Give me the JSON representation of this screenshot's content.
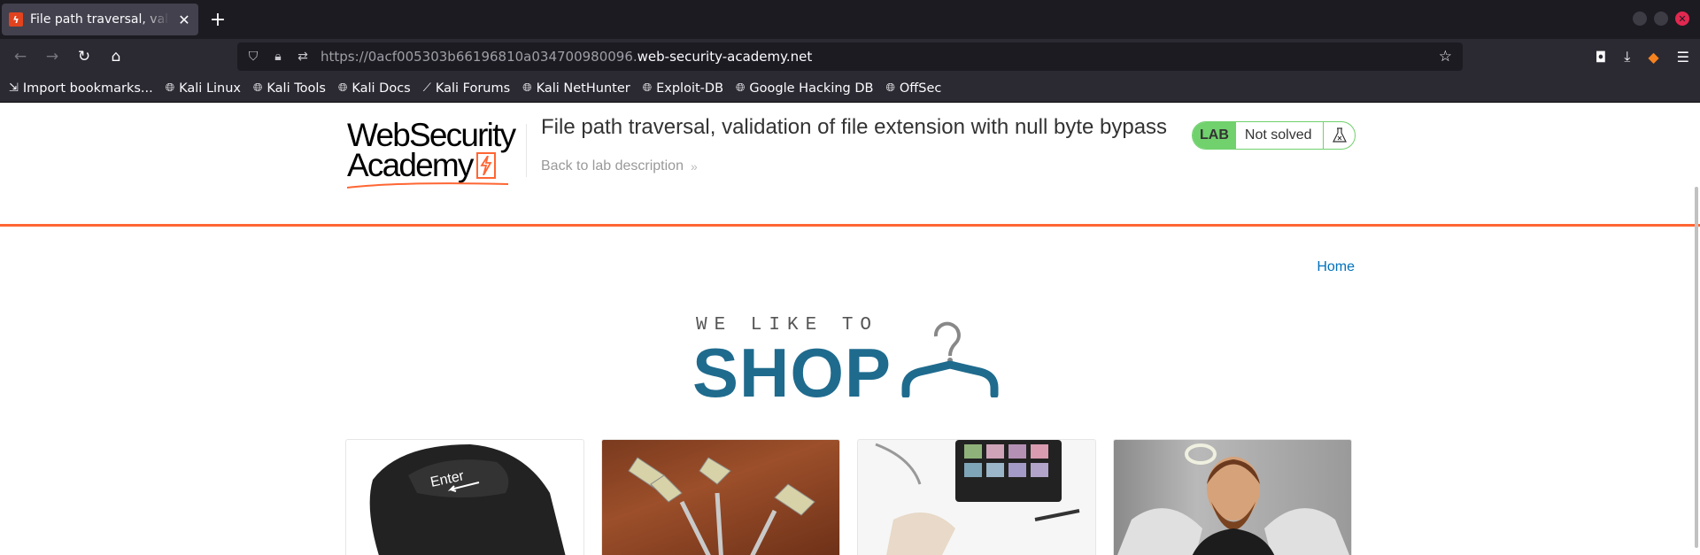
{
  "browser": {
    "tab_title": "File path traversal, validat",
    "url_prefix": "https://0acf005303b66196810a034700980096.",
    "url_host": "web-security-academy.net",
    "bookmarks": [
      {
        "label": "Import bookmarks...",
        "icon": "import-icon"
      },
      {
        "label": "Kali Linux",
        "icon": "globe-icon"
      },
      {
        "label": "Kali Tools",
        "icon": "globe-icon"
      },
      {
        "label": "Kali Docs",
        "icon": "globe-icon"
      },
      {
        "label": "Kali Forums",
        "icon": "kali-icon"
      },
      {
        "label": "Kali NetHunter",
        "icon": "globe-icon"
      },
      {
        "label": "Exploit-DB",
        "icon": "globe-icon"
      },
      {
        "label": "Google Hacking DB",
        "icon": "globe-icon"
      },
      {
        "label": "OffSec",
        "icon": "globe-icon"
      }
    ]
  },
  "lab": {
    "logo_line1": "WebSecurity",
    "logo_line2": "Academy",
    "title": "File path traversal, validation of file extension with null byte bypass",
    "back_link": "Back to lab description",
    "badge": "LAB",
    "status": "Not solved"
  },
  "nav": {
    "home": "Home"
  },
  "banner": {
    "tagline": "WE LIKE TO",
    "word": "SHOP"
  },
  "colors": {
    "accent_orange": "#ff6633",
    "lab_green": "#70d16d",
    "link_blue": "#0071bc",
    "shop_blue": "#1f6b8e"
  }
}
